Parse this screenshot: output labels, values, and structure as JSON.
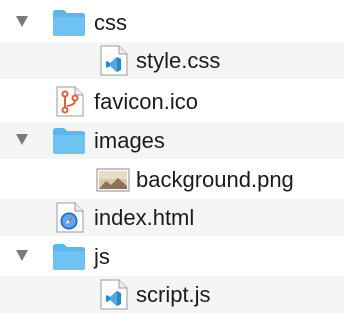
{
  "tree": {
    "items": [
      {
        "label": "css",
        "type": "folder",
        "expanded": true,
        "icon": "folder-icon"
      },
      {
        "label": "style.css",
        "type": "file",
        "icon": "vscode-file-icon"
      },
      {
        "label": "favicon.ico",
        "type": "file",
        "icon": "git-branch-file-icon"
      },
      {
        "label": "images",
        "type": "folder",
        "expanded": true,
        "icon": "folder-icon"
      },
      {
        "label": "background.png",
        "type": "file",
        "icon": "image-file-icon"
      },
      {
        "label": "index.html",
        "type": "file",
        "icon": "safari-file-icon"
      },
      {
        "label": "js",
        "type": "folder",
        "expanded": true,
        "icon": "folder-icon"
      },
      {
        "label": "script.js",
        "type": "file",
        "icon": "vscode-file-icon"
      }
    ]
  },
  "colors": {
    "folder": "#5ab7ee",
    "row_alt": "#f4f5f5",
    "text": "#1b1b1b",
    "disclosure": "#7a7a7a"
  }
}
